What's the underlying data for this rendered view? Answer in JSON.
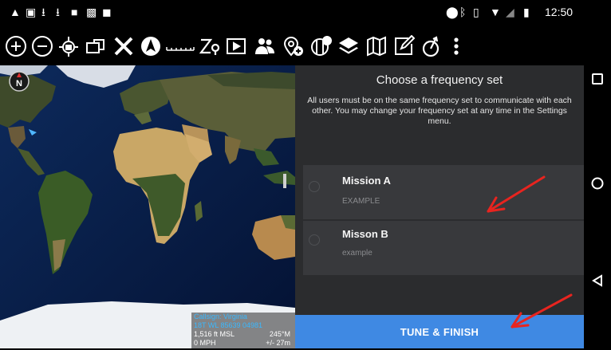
{
  "status_bar": {
    "time": "12:50",
    "left_icons": [
      "alert-icon",
      "image-icon",
      "download-icon",
      "download-icon",
      "video-icon",
      "gallery-icon",
      "android-icon"
    ],
    "right_icons": [
      "location-icon",
      "bluetooth-icon",
      "vibrate-icon",
      "wifi-icon",
      "no-signal-icon",
      "battery-icon"
    ]
  },
  "toolbar": {
    "icons": [
      "zoom-in-icon",
      "zoom-out-icon",
      "gps-lock-icon",
      "overlay-icon",
      "close-x-icon",
      "nav-tool-icon",
      "range-ruler-icon",
      "bloodhound-icon",
      "video-player-icon",
      "contacts-icon",
      "add-marker-icon",
      "cot-icon",
      "layers-icon",
      "map-icon",
      "draw-icon",
      "tracks-icon",
      "overflow-menu-icon"
    ],
    "color": "#ffffff"
  },
  "nav_bar": {
    "icons": [
      "recent-apps-icon",
      "home-icon",
      "back-icon"
    ]
  },
  "map": {
    "compass_label": "N",
    "info": {
      "callsign": "Callsign: Virginia",
      "grid": "18T WL 85639 04981",
      "altitude": "1,516 ft MSL",
      "heading": "245°M",
      "speed": "0 MPH",
      "error": "+/- 27m"
    }
  },
  "panel": {
    "title": "Choose a frequency set",
    "description": "All users must be on the same frequency set to communicate with each other. You may change your frequency set at any time in the Settings menu.",
    "options": [
      {
        "name": "Mission A",
        "subtitle": "EXAMPLE"
      },
      {
        "name": "Misson B",
        "subtitle": "example"
      }
    ],
    "button_label": "TUNE & FINISH",
    "colors": {
      "background": "#2b2c2e",
      "option": "#38393c",
      "button": "#3f89e3",
      "annotation_arrow": "#e8241f"
    }
  }
}
